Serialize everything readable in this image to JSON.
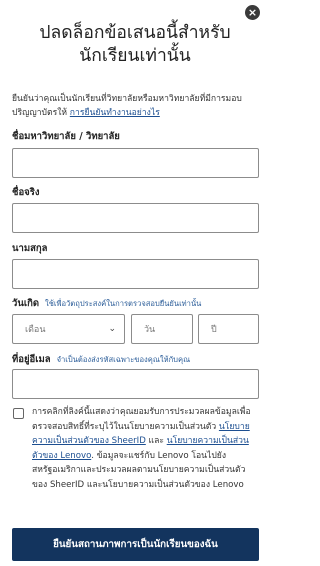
{
  "close_label": "×",
  "title": "ปลดล็อกข้อเสนอนี้สำหรับนักเรียนเท่านั้น",
  "intro": {
    "text": "ยืนยันว่าคุณเป็นนักเรียนที่วิทยาลัยหรือมหาวิทยาลัยที่มีการมอบปริญญาบัตรให้ ",
    "link": "การยืนยันทำงานอย่างไร"
  },
  "fields": {
    "university": {
      "label": "ชื่อมหาวิทยาลัย / วิทยาลัย",
      "value": ""
    },
    "first_name": {
      "label": "ชื่อจริง",
      "value": ""
    },
    "last_name": {
      "label": "นามสกุล",
      "value": ""
    },
    "birth_date": {
      "label": "วันเกิด",
      "hint": "ใช้เพื่อวัตถุประสงค์ในการตรวจสอบยืนยันเท่านั้น",
      "month_placeholder": "เดือน",
      "day_placeholder": "วัน",
      "year_placeholder": "ปี"
    },
    "email": {
      "label": "ที่อยู่อีเมล",
      "hint": "จำเป็นต้องส่งรหัสเฉพาะของคุณให้กับคุณ",
      "value": ""
    }
  },
  "consent": {
    "checked": false,
    "text_1": "การคลิกที่ลิงค์นี้แสดงว่าคุณยอมรับการประมวลผลข้อมูลเพื่อตรวจสอบสิทธิ์ที่ระบุไว้ในนโยบายความเป็นส่วนตัว ",
    "link_1": "นโยบายความเป็นส่วนตัวของ SheerID",
    "text_2": " และ ",
    "link_2": "นโยบายความเป็นส่วนตัวของ Lenovo",
    "text_3": ". ข้อมูลจะแชร์กับ Lenovo โอนไปยังสหรัฐอเมริกาและประมวลผลตามนโยบายความเป็นส่วนตัวของ SheerID และนโยบายความเป็นส่วนตัวของ Lenovo"
  },
  "submit_label": "ยืนยันสถานภาพการเป็นนักเรียนของฉัน",
  "colors": {
    "button_bg": "#13345e",
    "link": "#1d4f91",
    "hint": "#2b5d99"
  },
  "icons": {
    "close": "close-icon",
    "month_chevron": "chevron-down-icon"
  }
}
